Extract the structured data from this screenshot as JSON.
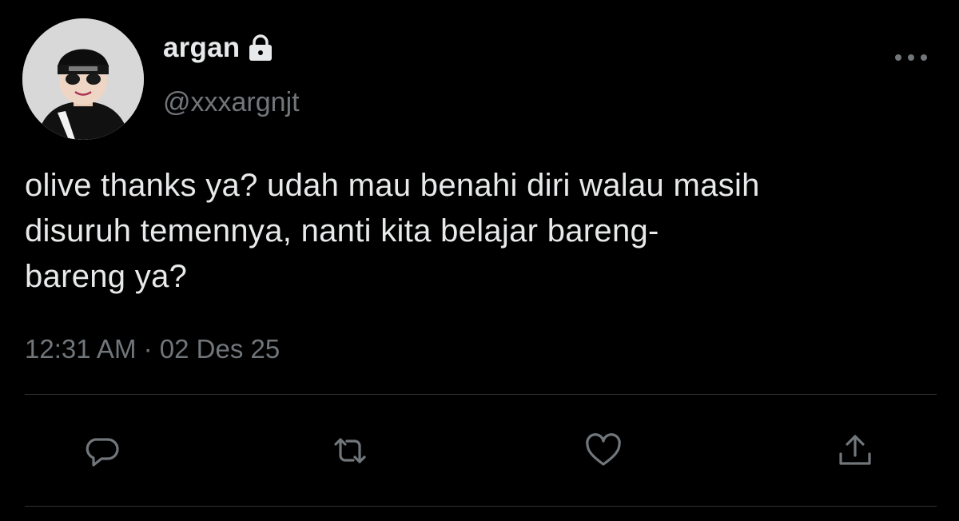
{
  "user": {
    "display_name": "argan",
    "handle": "@xxxargnjt",
    "avatar_icon": "avatar-photo",
    "protected_icon": "lock-icon"
  },
  "tweet": {
    "text": "olive thanks ya? udah mau benahi diri walau masih\ndisuruh temennya, nanti kita belajar bareng-\nbareng ya?",
    "time": "12:31 AM",
    "separator": "·",
    "date": "02 Des 25"
  },
  "actions": [
    {
      "name": "reply",
      "icon": "reply-icon"
    },
    {
      "name": "retweet",
      "icon": "retweet-icon"
    },
    {
      "name": "like",
      "icon": "heart-icon"
    },
    {
      "name": "share",
      "icon": "share-icon"
    }
  ],
  "colors": {
    "background": "#000000",
    "text": "#e7e9ea",
    "muted": "#71767b",
    "divider": "#2f3336"
  }
}
